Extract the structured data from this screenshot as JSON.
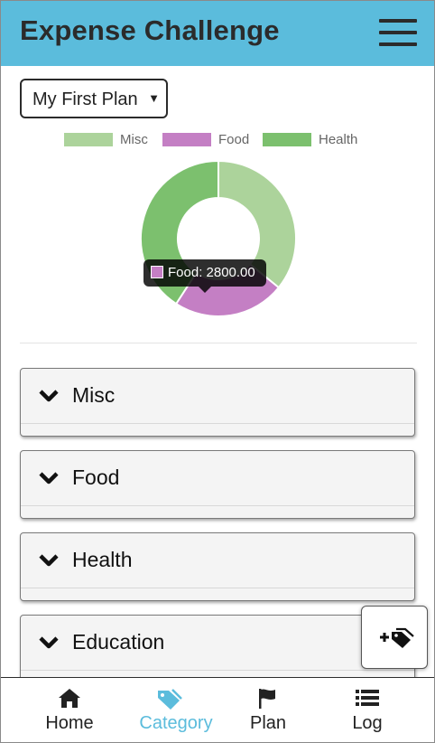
{
  "app": {
    "title": "Expense Challenge"
  },
  "plan_select": {
    "selected": "My First Plan"
  },
  "legend": [
    {
      "label": "Misc",
      "color": "#acd39b"
    },
    {
      "label": "Food",
      "color": "#c47fc4"
    },
    {
      "label": "Health",
      "color": "#7cc06e"
    }
  ],
  "chart_data": {
    "type": "pie",
    "variant": "doughnut",
    "categories": [
      "Misc",
      "Food",
      "Health"
    ],
    "values": [
      4300,
      2800,
      4900
    ],
    "colors": [
      "#acd39b",
      "#c47fc4",
      "#7cc06e"
    ],
    "legend_position": "top",
    "tooltip": {
      "category": "Food",
      "text": "Food: 2800.00"
    }
  },
  "categories": [
    {
      "label": "Misc"
    },
    {
      "label": "Food"
    },
    {
      "label": "Health"
    },
    {
      "label": "Education"
    }
  ],
  "fab": {
    "icon": "add-tag-icon"
  },
  "nav": {
    "active": "Category",
    "items": [
      {
        "label": "Home",
        "icon": "home-icon"
      },
      {
        "label": "Category",
        "icon": "tags-icon"
      },
      {
        "label": "Plan",
        "icon": "flag-icon"
      },
      {
        "label": "Log",
        "icon": "list-icon"
      }
    ]
  },
  "colors": {
    "header": "#5bbcdc",
    "active_nav": "#5bbcdc"
  }
}
